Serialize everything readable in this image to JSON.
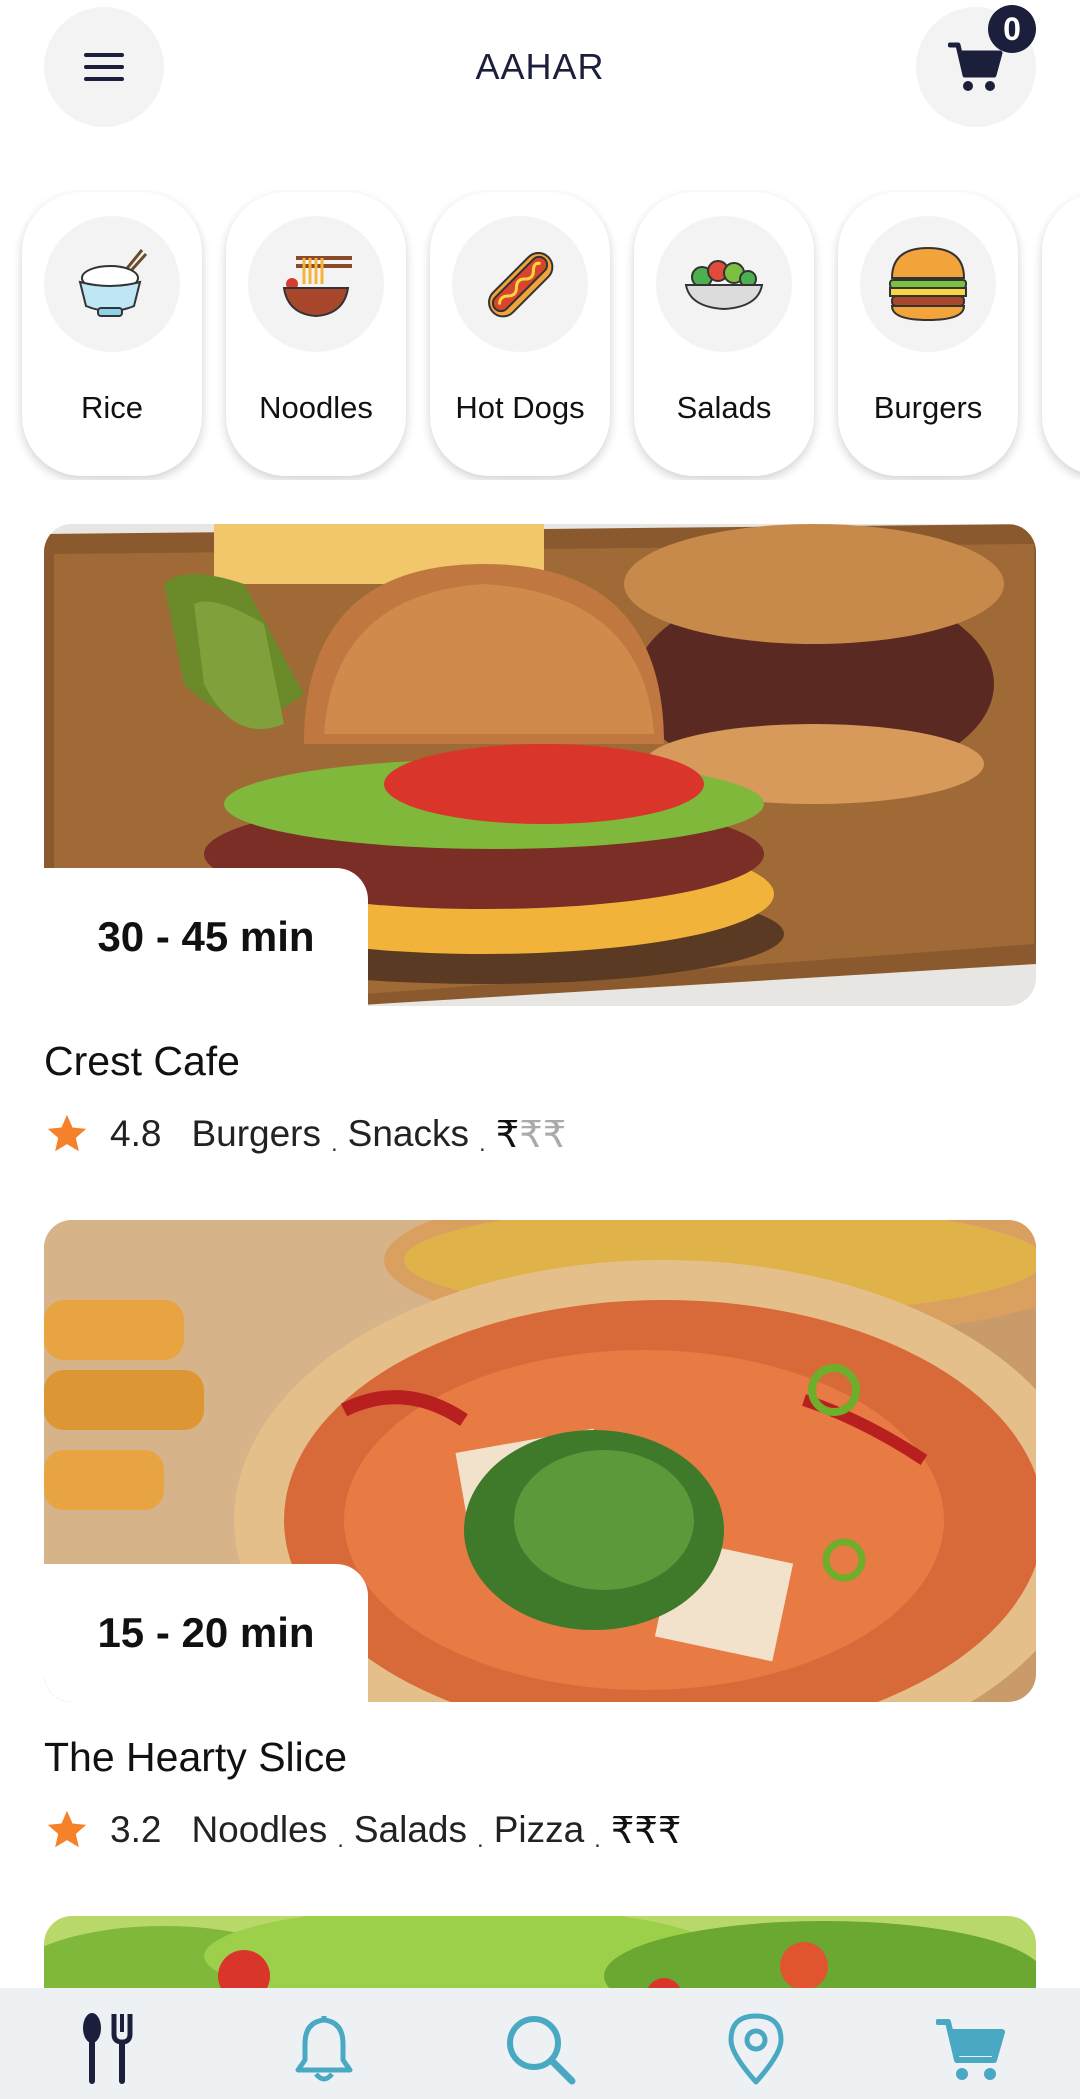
{
  "header": {
    "title": "AAHAR",
    "cart_count": "0",
    "menu_icon": "hamburger-menu-icon",
    "cart_icon": "cart-icon"
  },
  "categories": [
    {
      "label": "Rice",
      "icon": "rice-bowl-icon"
    },
    {
      "label": "Noodles",
      "icon": "noodles-bowl-icon"
    },
    {
      "label": "Hot Dogs",
      "icon": "hot-dog-icon"
    },
    {
      "label": "Salads",
      "icon": "salad-bowl-icon"
    },
    {
      "label": "Burgers",
      "icon": "burger-icon"
    }
  ],
  "restaurants": [
    {
      "name": "Crest Cafe",
      "time": "30 - 45 min",
      "rating": "4.8",
      "tags": [
        "Burgers",
        "Snacks"
      ],
      "price_active": "₹",
      "price_inactive": "₹₹",
      "image": "burger-photo"
    },
    {
      "name": "The Hearty Slice",
      "time": "15 - 20 min",
      "rating": "3.2",
      "tags": [
        "Noodles",
        "Salads",
        "Pizza"
      ],
      "price_active": "₹₹₹",
      "price_inactive": "",
      "image": "pizza-photo"
    }
  ],
  "bottom_nav": [
    {
      "icon": "fork-knife-icon",
      "active": true
    },
    {
      "icon": "bell-icon",
      "active": false
    },
    {
      "icon": "search-icon",
      "active": false
    },
    {
      "icon": "location-pin-icon",
      "active": false
    },
    {
      "icon": "cart-icon",
      "active": false
    }
  ],
  "colors": {
    "primary_dark": "#1b1f3b",
    "nav_inactive": "#4aa9c2",
    "star": "#f5822a",
    "nav_background": "#eef1f3"
  }
}
